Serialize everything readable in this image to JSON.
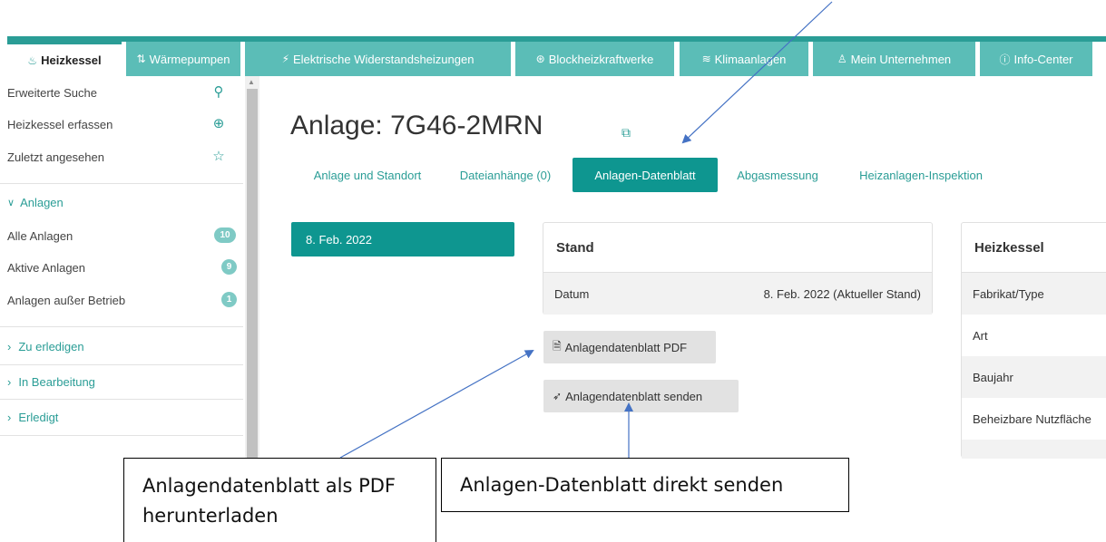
{
  "tabs": [
    {
      "icon": "heater-icon",
      "glyph": "♨",
      "label": "Heizkessel",
      "active": true
    },
    {
      "icon": "heatpump-icon",
      "glyph": "⇅",
      "label": "Wärmepumpen"
    },
    {
      "icon": "bolt-icon",
      "glyph": "⚡",
      "label": "Elektrische Widerstandsheizungen"
    },
    {
      "icon": "cogeneration-icon",
      "glyph": "⊛",
      "label": "Blockheizkraftwerke"
    },
    {
      "icon": "aircon-icon",
      "glyph": "≋",
      "label": "Klimaanlagen"
    },
    {
      "icon": "user-icon",
      "glyph": "♙",
      "label": "Mein Unternehmen"
    },
    {
      "icon": "info-icon",
      "glyph": "ⓘ",
      "label": "Info-Center"
    }
  ],
  "sidebar": {
    "items": [
      {
        "label": "Erweiterte Suche",
        "icon": "search-icon",
        "glyph": "⚲"
      },
      {
        "label": "Heizkessel erfassen",
        "icon": "add-circle-icon",
        "glyph": "⊕"
      },
      {
        "label": "Zuletzt angesehen",
        "icon": "star-icon",
        "glyph": "☆"
      }
    ],
    "anlagen_section": {
      "label": "Anlagen",
      "chevron": "chevron-down-icon"
    },
    "anlagen_items": [
      {
        "label": "Alle Anlagen",
        "count": "10"
      },
      {
        "label": "Aktive Anlagen",
        "count": "9"
      },
      {
        "label": "Anlagen außer Betrieb",
        "count": "1"
      }
    ],
    "sections": [
      {
        "label": "Zu erledigen"
      },
      {
        "label": "In Bearbeitung"
      },
      {
        "label": "Erledigt"
      }
    ]
  },
  "main": {
    "title": "Anlage: 7G46-2MRN",
    "subtabs": [
      {
        "label": "Anlage und Standort"
      },
      {
        "label": "Dateianhänge (0)"
      },
      {
        "label": "Anlagen-Datenblatt",
        "active": true
      },
      {
        "label": "Abgasmessung"
      },
      {
        "label": "Heizanlagen-Inspektion"
      }
    ],
    "date_selector": "8. Feb. 2022",
    "stand_card": {
      "title": "Stand",
      "row_label": "Datum",
      "row_value": "8. Feb. 2022 (Aktueller Stand)"
    },
    "pdf_button": "Anlagendatenblatt PDF",
    "send_button": "Anlagendatenblatt senden",
    "heizkessel_card": {
      "title": "Heizkessel",
      "rows": [
        "Fabrikat/Type",
        "Art",
        "Baujahr",
        "Beheizbare Nutzfläche"
      ]
    }
  },
  "annotations": {
    "pdf_callout": "Anlagendatenblatt als PDF herunterladen",
    "send_callout": "Anlagen-Datenblatt direkt senden"
  },
  "colors": {
    "accent": "#0e9690",
    "tab_bg": "#5bbdb7",
    "badge": "#7fcac5"
  }
}
